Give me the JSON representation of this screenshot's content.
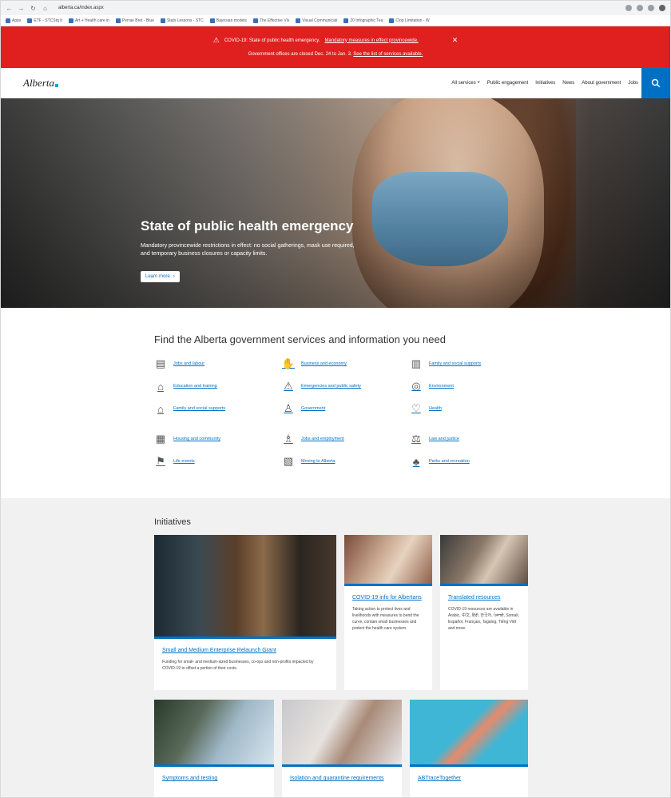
{
  "browser": {
    "url": "alberta.ca/index.aspx",
    "bookmarks": [
      "Apps",
      "ETF - STCStq It",
      "Art + Health care in",
      "Perrae Bret - Blue",
      "Stats Lessons - STC",
      "Bayesian models",
      "The Effective Vis",
      "Visual Communicati",
      "20 Infographic Tea",
      "Clop Limitation - W"
    ]
  },
  "alert": {
    "line1_text": "COVID-19: State of public health emergency.",
    "line1_link": "Mandatory measures in effect provincewide.",
    "line2_text": "Government offices are closed Dec. 24 to Jan. 3.",
    "line2_link": "See the list of services available."
  },
  "header": {
    "logo": "Alberta",
    "nav": [
      "All services ˅",
      "Public engagement",
      "Initiatives",
      "News",
      "About government",
      "Jobs"
    ]
  },
  "hero": {
    "title": "State of public health emergency",
    "description": "Mandatory provincewide restrictions in effect: no social gatherings, mask use required, and temporary business closures or capacity limits.",
    "button": "Learn more"
  },
  "services": {
    "heading": "Find the Alberta government services and information you need",
    "group1": [
      {
        "icon": "idcard-icon",
        "label": "Jobs and labour"
      },
      {
        "icon": "handshake-icon",
        "label": "Business and economy"
      },
      {
        "icon": "building-icon",
        "label": "Family and social supports"
      },
      {
        "icon": "graduation-cap-icon",
        "label": "Education and training"
      },
      {
        "icon": "warning-icon",
        "label": "Emergencies and public safety"
      },
      {
        "icon": "globe-icon",
        "label": "Environment"
      },
      {
        "icon": "house-icon",
        "label": "Family and social supports"
      },
      {
        "icon": "people-icon",
        "label": "Government"
      },
      {
        "icon": "heart-icon",
        "label": "Health"
      }
    ],
    "group2": [
      {
        "icon": "community-icon",
        "label": "Housing and community"
      },
      {
        "icon": "worker-icon",
        "label": "Jobs and employment"
      },
      {
        "icon": "scales-icon",
        "label": "Law and justice"
      },
      {
        "icon": "flag-icon",
        "label": "Life events"
      },
      {
        "icon": "map-icon",
        "label": "Moving to Alberta"
      },
      {
        "icon": "recreation-icon",
        "label": "Parks and recreation"
      }
    ]
  },
  "initiatives": {
    "heading": "Initiatives",
    "cards": [
      {
        "title": "Small and Medium Enterprise Relaunch Grant",
        "desc": "Funding for small- and medium-sized businesses, co-ops and non-profits impacted by COVID-19 to offset a portion of their costs."
      },
      {
        "title": "COVID-19 info for Albertans",
        "desc": "Taking action to protect lives and livelihoods with measures to bend the curve, contain small businesses and protect the health care system."
      },
      {
        "title": "Translated resources",
        "desc": "COVID-19 resources are available in Arabic, 中文, हिंदी, 한국어, ਪੰਜਾਬੀ, Somali, Español, Français, Tagalog, Tiếng Việt and more."
      },
      {
        "title": "Symptoms and testing",
        "desc": ""
      },
      {
        "title": "Isolation and quarantine requirements",
        "desc": ""
      },
      {
        "title": "ABTraceTogether",
        "desc": ""
      }
    ]
  }
}
